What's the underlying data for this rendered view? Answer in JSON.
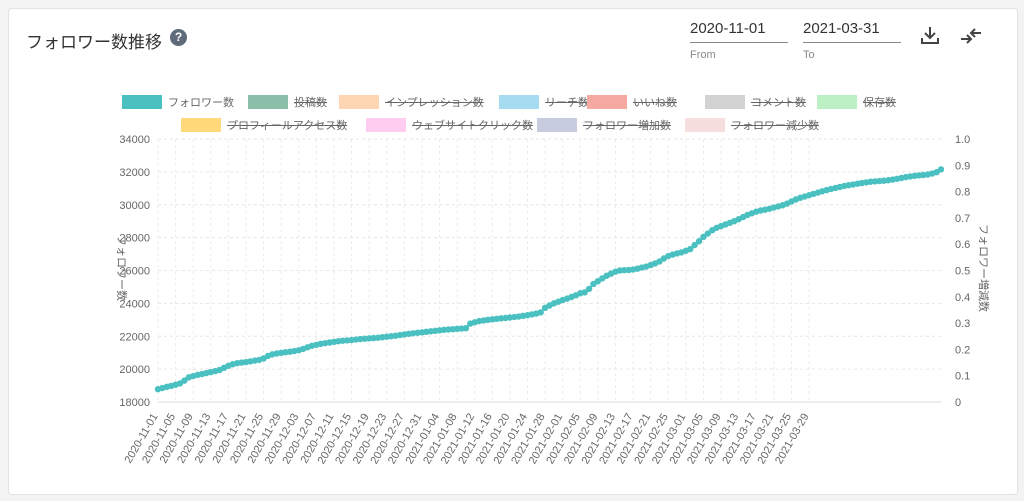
{
  "header": {
    "title": "フォロワー数推移",
    "help_icon": "question-circle-icon",
    "from_value": "2020-11-01",
    "from_label": "From",
    "to_value": "2021-03-31",
    "to_label": "To",
    "download_icon": "download-icon",
    "compare_icon": "swap-arrows-icon"
  },
  "legend": [
    {
      "label": "フォロワー数",
      "color": "#4bc0c0",
      "active": true
    },
    {
      "label": "投稿数",
      "color": "#8bbfaa",
      "active": false
    },
    {
      "label": "インプレッション数",
      "color": "#ffd6b3",
      "active": false
    },
    {
      "label": "リーチ数",
      "color": "#a6dcf2",
      "active": false
    },
    {
      "label": "いいね数",
      "color": "#f6a9a1",
      "active": false
    },
    {
      "label": "コメント数",
      "color": "#d2d2d2",
      "active": false
    },
    {
      "label": "保存数",
      "color": "#bdf0c5",
      "active": false
    },
    {
      "label": "プロフィールアクセス数",
      "color": "#ffd97a",
      "active": false
    },
    {
      "label": "ウェブサイトクリック数",
      "color": "#ffcdf0",
      "active": false
    },
    {
      "label": "フォロワー増加数",
      "color": "#c8cce0",
      "active": false
    },
    {
      "label": "フォロワー減少数",
      "color": "#f6dede",
      "active": false
    }
  ],
  "chart_data": {
    "type": "line",
    "ylabel": "フォロワー数",
    "y2label": "フォロワー増減数",
    "ylim": [
      18000,
      34000
    ],
    "y_ticks": [
      "18000",
      "20000",
      "22000",
      "24000",
      "26000",
      "28000",
      "30000",
      "32000",
      "34000"
    ],
    "y2lim": [
      0,
      1
    ],
    "y2_ticks": [
      "0",
      "0.1",
      "0.2",
      "0.3",
      "0.4",
      "0.5",
      "0.6",
      "0.7",
      "0.8",
      "0.9",
      "1.0"
    ],
    "x_start": "2020-11-01",
    "x_tick_labels": [
      "2020-11-01",
      "2020-11-05",
      "2020-11-09",
      "2020-11-13",
      "2020-11-17",
      "2020-11-21",
      "2020-11-25",
      "2020-11-29",
      "2020-12-03",
      "2020-12-07",
      "2020-12-11",
      "2020-12-15",
      "2020-12-19",
      "2020-12-23",
      "2020-12-27",
      "2020-12-31",
      "2021-01-04",
      "2021-01-08",
      "2021-01-12",
      "2021-01-16",
      "2021-01-20",
      "2021-01-24",
      "2021-01-28",
      "2021-02-01",
      "2021-02-05",
      "2021-02-09",
      "2021-02-13",
      "2021-02-17",
      "2021-02-21",
      "2021-02-25",
      "2021-03-01",
      "2021-03-05",
      "2021-03-09",
      "2021-03-13",
      "2021-03-17",
      "2021-03-21",
      "2021-03-25",
      "2021-03-29"
    ],
    "grid": true,
    "legend_position": "top-center",
    "series": [
      {
        "name": "フォロワー数",
        "color": "#4bc0c0",
        "values": [
          18780,
          18850,
          18920,
          18980,
          19050,
          19130,
          19300,
          19500,
          19580,
          19650,
          19700,
          19760,
          19820,
          19880,
          19950,
          20080,
          20200,
          20300,
          20360,
          20400,
          20430,
          20470,
          20520,
          20560,
          20650,
          20800,
          20900,
          20950,
          20990,
          21030,
          21060,
          21100,
          21150,
          21230,
          21330,
          21420,
          21480,
          21540,
          21580,
          21620,
          21660,
          21700,
          21730,
          21750,
          21770,
          21800,
          21830,
          21850,
          21870,
          21890,
          21910,
          21940,
          21970,
          22000,
          22030,
          22070,
          22110,
          22150,
          22180,
          22210,
          22240,
          22270,
          22300,
          22330,
          22360,
          22390,
          22410,
          22430,
          22450,
          22470,
          22490,
          22770,
          22850,
          22920,
          22960,
          23000,
          23030,
          23060,
          23090,
          23110,
          23140,
          23170,
          23200,
          23240,
          23280,
          23330,
          23380,
          23450,
          23730,
          23870,
          24000,
          24100,
          24200,
          24290,
          24390,
          24490,
          24620,
          24670,
          24880,
          25180,
          25350,
          25520,
          25680,
          25810,
          25930,
          26000,
          26020,
          26030,
          26060,
          26110,
          26180,
          26240,
          26330,
          26430,
          26550,
          26730,
          26880,
          26970,
          27040,
          27100,
          27200,
          27300,
          27550,
          27780,
          28050,
          28250,
          28450,
          28600,
          28700,
          28800,
          28900,
          29000,
          29120,
          29250,
          29380,
          29480,
          29580,
          29650,
          29700,
          29760,
          29830,
          29900,
          29970,
          30070,
          30200,
          30320,
          30420,
          30500,
          30580,
          30660,
          30740,
          30820,
          30890,
          30960,
          31020,
          31080,
          31140,
          31190,
          31230,
          31280,
          31320,
          31360,
          31400,
          31420,
          31440,
          31460,
          31490,
          31530,
          31580,
          31630,
          31680,
          31720,
          31760,
          31790,
          31810,
          31840,
          31900,
          31980,
          32150
        ]
      }
    ]
  }
}
